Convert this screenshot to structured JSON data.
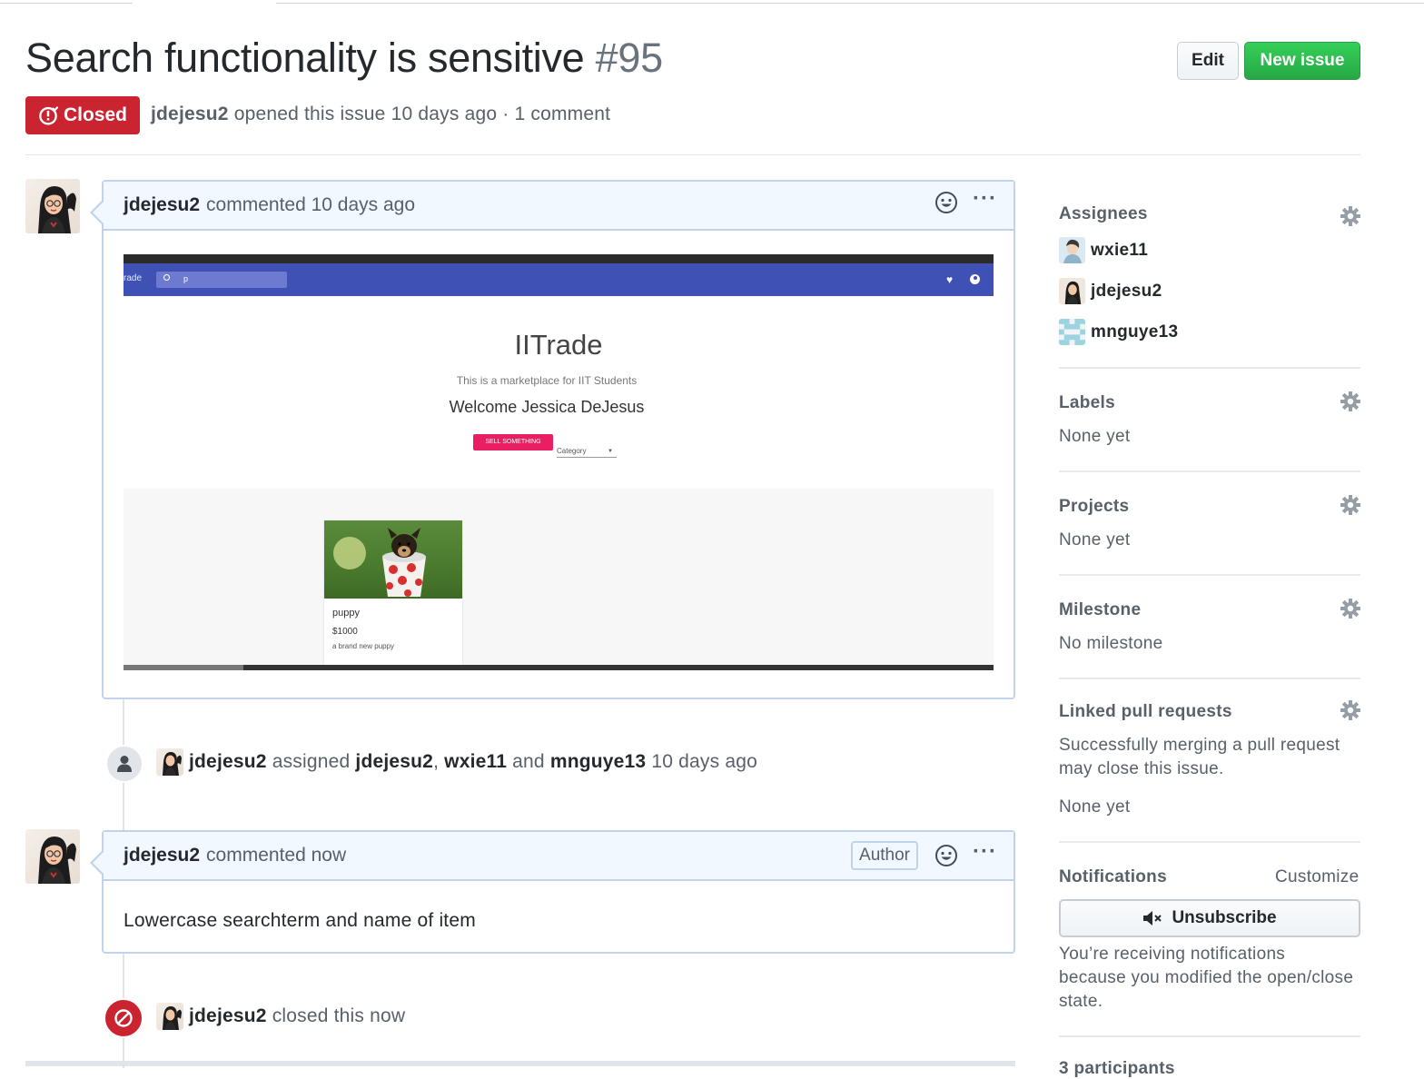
{
  "issue": {
    "title": "Search functionality is sensitive",
    "number": "#95",
    "state": "Closed",
    "author": "jdejesu2",
    "opened_text": "opened this issue 10 days ago · 1 comment"
  },
  "header_actions": {
    "edit_label": "Edit",
    "new_issue_label": "New issue"
  },
  "comments": [
    {
      "author": "jdejesu2",
      "meta": "commented 10 days ago",
      "embedded_screenshot": {
        "brand": "rade",
        "search_query": "p",
        "title": "IITrade",
        "subtitle": "This is a marketplace for IIT Students",
        "welcome": "Welcome Jessica DeJesus",
        "sell_button": "SELL SOMETHING",
        "category_label": "Category",
        "item": {
          "name": "puppy",
          "price": "$1000",
          "description": "a brand new puppy"
        }
      }
    },
    {
      "author": "jdejesu2",
      "meta": "commented now",
      "badge": "Author",
      "body": "Lowercase searchterm and name of item"
    }
  ],
  "events": {
    "assigned": {
      "actor": "jdejesu2",
      "verb": "assigned",
      "assignee_1": "jdejesu2",
      "assignee_2": "wxie11",
      "conj": "and",
      "assignee_3": "mnguye13",
      "time": "10 days ago"
    },
    "closed": {
      "actor": "jdejesu2",
      "text": "closed this now"
    }
  },
  "sidebar": {
    "assignees": {
      "title": "Assignees",
      "people": [
        "wxie11",
        "jdejesu2",
        "mnguye13"
      ]
    },
    "labels": {
      "title": "Labels",
      "value": "None yet"
    },
    "projects": {
      "title": "Projects",
      "value": "None yet"
    },
    "milestone": {
      "title": "Milestone",
      "value": "No milestone"
    },
    "linked_prs": {
      "title": "Linked pull requests",
      "line_1": "Successfully merging a pull request",
      "line_2": "may close this issue.",
      "value": "None yet"
    },
    "notifications": {
      "title": "Notifications",
      "customize": "Customize",
      "unsubscribe": "Unsubscribe",
      "line_1": "You’re receiving notifications",
      "line_2": "because you modified the open/close",
      "line_3": "state."
    },
    "participants": {
      "title": "3 participants"
    }
  },
  "colors": {
    "closed_red": "#cb2431",
    "new_issue_green": "#28a745",
    "comment_header_bg": "#f1f8ff",
    "app_bar_indigo": "#3f51b5",
    "sell_button_pink": "#e91e63"
  },
  "icons": {
    "closed_badge": "issue-closed-icon",
    "comment_reaction": "smiley-icon",
    "comment_menu": "kebab-horizontal-icon",
    "assign_event": "person-icon",
    "close_event": "circle-slash-icon",
    "sidebar_settings": "gear-icon",
    "unsubscribe": "mute-icon"
  }
}
